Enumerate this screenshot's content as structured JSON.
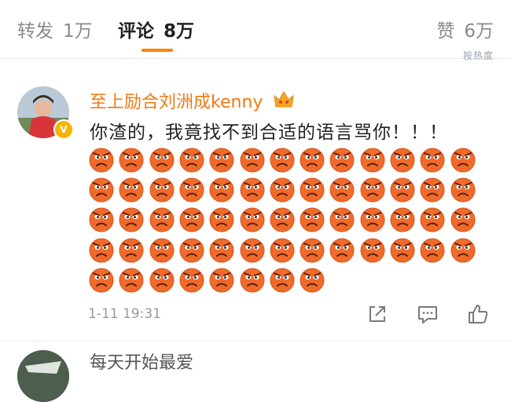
{
  "tabs": {
    "repost": {
      "label": "转发",
      "count": "1万"
    },
    "comments": {
      "label": "评论",
      "count": "8万"
    },
    "likes": {
      "label": "赞",
      "count": "6万"
    }
  },
  "sort_fragment": "按热度",
  "comment": {
    "username": "至上励合刘洲成kenny",
    "verified_mark": "V",
    "text": "你渣的，我竟找不到合适的语言骂你！！！",
    "emoji_name": "angry-face-emoji",
    "emoji_rows": [
      13,
      13,
      13,
      13,
      8
    ],
    "timestamp": "1-11 19:31"
  },
  "next_comment": {
    "username": "每天开始最爱"
  },
  "colors": {
    "accent": "#ff8200",
    "username": "#ee7a12",
    "emoji": "#f06a2b"
  },
  "icons": [
    "share-icon",
    "comment-icon",
    "like-icon",
    "crown-badge-icon",
    "verified-badge-icon"
  ]
}
